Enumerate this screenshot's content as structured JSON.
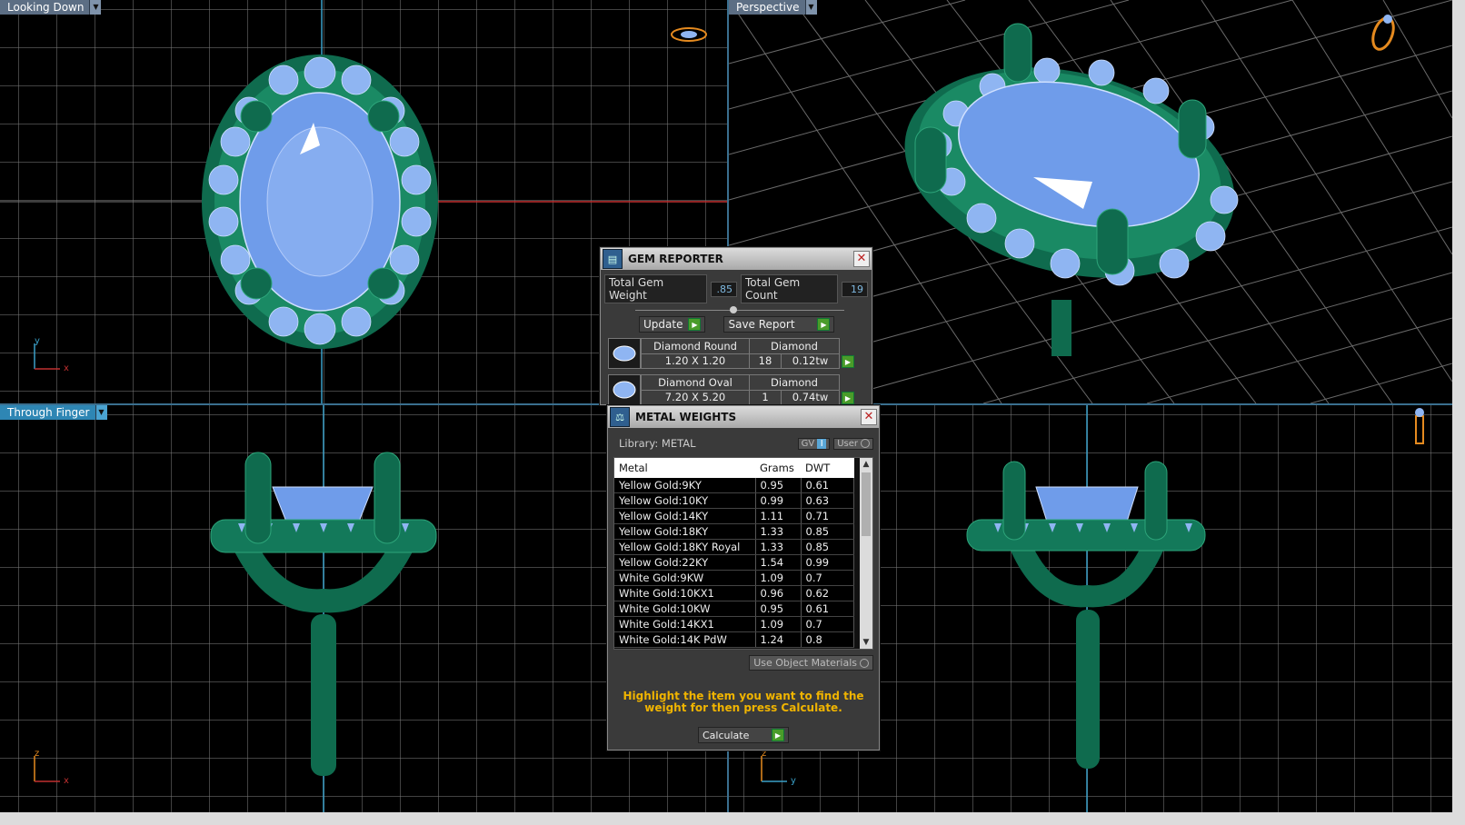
{
  "viewports": {
    "top_left": {
      "label": "Looking Down",
      "axis_v": "y",
      "axis_h": "x"
    },
    "top_right": {
      "label": "Perspective"
    },
    "bottom_left": {
      "label": "Through Finger",
      "axis_v": "z",
      "axis_h": "x"
    },
    "bottom_right": {
      "axis_v": "z",
      "axis_h": "y"
    }
  },
  "gem_reporter": {
    "title": "GEM REPORTER",
    "total_weight_label": "Total Gem Weight",
    "total_weight_value": ".85",
    "total_count_label": "Total Gem Count",
    "total_count_value": "19",
    "update_label": "Update",
    "save_label": "Save Report",
    "gems": [
      {
        "name": "Diamond Round",
        "material": "Diamond",
        "size": "1.20 X 1.20",
        "count": "18",
        "weight": "0.12tw"
      },
      {
        "name": "Diamond Oval",
        "material": "Diamond",
        "size": "7.20 X 5.20",
        "count": "1",
        "weight": "0.74tw"
      }
    ]
  },
  "metal_weights": {
    "title": "METAL WEIGHTS",
    "library_label": "Library: METAL",
    "gv_label": "GV",
    "user_label": "User",
    "columns": {
      "metal": "Metal",
      "grams": "Grams",
      "dwt": "DWT"
    },
    "rows": [
      {
        "metal": "Yellow Gold:9KY",
        "grams": "0.95",
        "dwt": "0.61"
      },
      {
        "metal": "Yellow Gold:10KY",
        "grams": "0.99",
        "dwt": "0.63"
      },
      {
        "metal": "Yellow Gold:14KY",
        "grams": "1.11",
        "dwt": "0.71"
      },
      {
        "metal": "Yellow Gold:18KY",
        "grams": "1.33",
        "dwt": "0.85"
      },
      {
        "metal": "Yellow Gold:18KY Royal",
        "grams": "1.33",
        "dwt": "0.85"
      },
      {
        "metal": "Yellow Gold:22KY",
        "grams": "1.54",
        "dwt": "0.99"
      },
      {
        "metal": "White Gold:9KW",
        "grams": "1.09",
        "dwt": "0.7"
      },
      {
        "metal": "White Gold:10KX1",
        "grams": "0.96",
        "dwt": "0.62"
      },
      {
        "metal": "White Gold:10KW",
        "grams": "0.95",
        "dwt": "0.61"
      },
      {
        "metal": "White Gold:14KX1",
        "grams": "1.09",
        "dwt": "0.7"
      },
      {
        "metal": "White Gold:14K PdW",
        "grams": "1.24",
        "dwt": "0.8"
      }
    ],
    "use_object_materials": "Use Object Materials",
    "hint": "Highlight the item you want to find the weight for then press Calculate.",
    "calculate_label": "Calculate"
  }
}
